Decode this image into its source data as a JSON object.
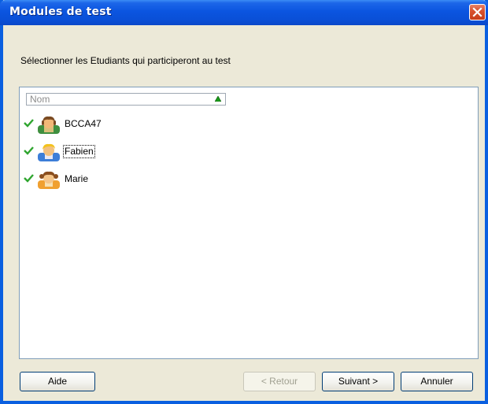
{
  "window": {
    "title": "Modules de test"
  },
  "instruction": "Sélectionner les Etudiants qui participeront au test",
  "list": {
    "column_header": "Nom",
    "items": [
      {
        "name": "BCCA47",
        "checked": true,
        "avatar": "student-avatar-green-icon"
      },
      {
        "name": "Fabien",
        "checked": true,
        "avatar": "student-avatar-blue-icon"
      },
      {
        "name": "Marie",
        "checked": true,
        "avatar": "student-avatar-orange-icon"
      }
    ]
  },
  "buttons": {
    "help": "Aide",
    "back": "< Retour",
    "next": "Suivant >",
    "cancel": "Annuler"
  },
  "colors": {
    "titlebar": "#0a4fd6",
    "close": "#d9532f",
    "window_bg": "#ece9d8",
    "check": "#2fa52f"
  }
}
